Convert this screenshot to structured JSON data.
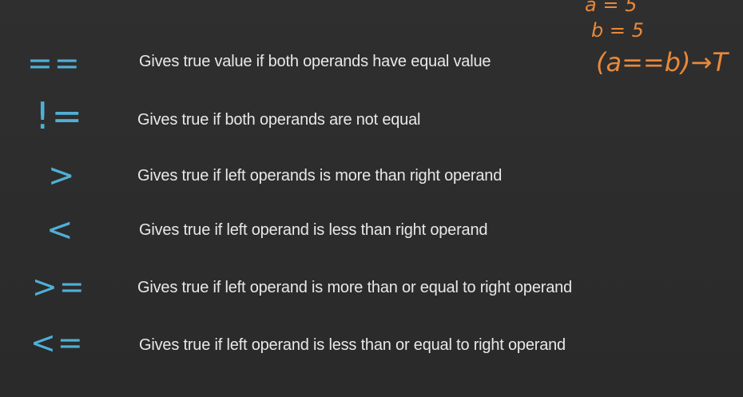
{
  "operators": [
    {
      "symbol": "==",
      "description": "Gives true value if both operands have equal value"
    },
    {
      "symbol": "!=",
      "description": "Gives true if both operands are not equal"
    },
    {
      "symbol": ">",
      "description": "Gives true if left operands is more than right operand"
    },
    {
      "symbol": "<",
      "description": "Gives true if left operand is less than right operand"
    },
    {
      "symbol": ">=",
      "description": "Gives true if left operand is more than or equal to right operand"
    },
    {
      "symbol": "<=",
      "description": "Gives true if left operand is less than or equal to right operand"
    }
  ],
  "annotation": {
    "line1": "a = 5",
    "line2": "b = 5",
    "expression": "(a==b)→T"
  },
  "colors": {
    "background": "#2c2c2c",
    "symbol": "#4fb0d6",
    "text": "#e8e8e8",
    "annotation": "#e8893a"
  }
}
